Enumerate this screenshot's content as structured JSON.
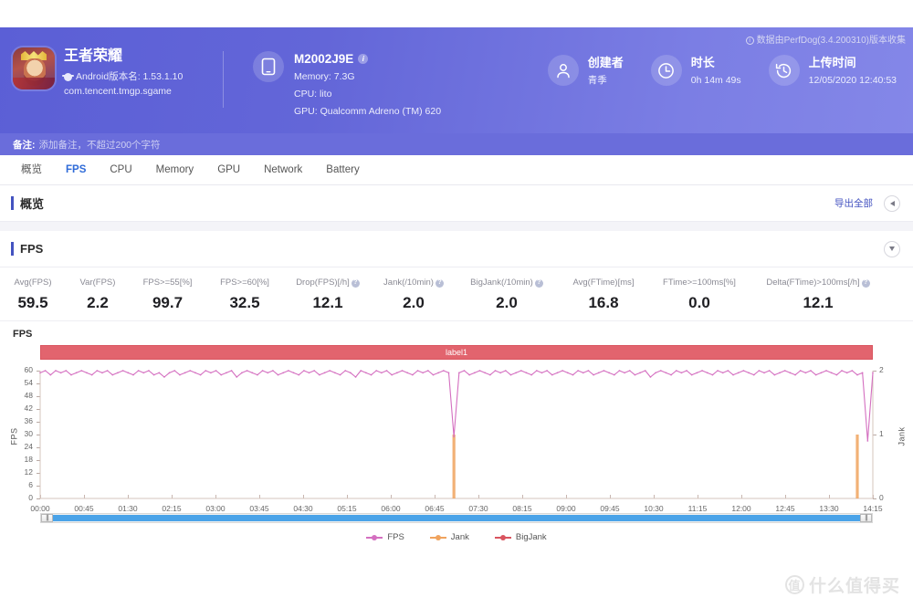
{
  "header": {
    "collector_note": "数据由PerfDog(3.4.200310)版本收集",
    "app": {
      "name": "王者荣耀",
      "version_line": "Android版本名: 1.53.1.10",
      "package": "com.tencent.tmgp.sgame"
    },
    "device": {
      "model": "M2002J9E",
      "memory": "Memory: 7.3G",
      "cpu": "CPU: lito",
      "gpu": "GPU: Qualcomm Adreno (TM) 620"
    },
    "meta": [
      {
        "icon": "user-icon",
        "label": "创建者",
        "value": "青季"
      },
      {
        "icon": "clock-icon",
        "label": "时长",
        "value": "0h 14m 49s"
      },
      {
        "icon": "history-icon",
        "label": "上传时间",
        "value": "12/05/2020 12:40:53"
      }
    ],
    "note": {
      "label": "备注:",
      "placeholder": "添加备注，不超过200个字符"
    }
  },
  "tabs": [
    {
      "label": "概览",
      "active": false
    },
    {
      "label": "FPS",
      "active": true
    },
    {
      "label": "CPU",
      "active": false
    },
    {
      "label": "Memory",
      "active": false
    },
    {
      "label": "GPU",
      "active": false
    },
    {
      "label": "Network",
      "active": false
    },
    {
      "label": "Battery",
      "active": false
    }
  ],
  "overview_section": {
    "title": "概览",
    "export_label": "导出全部"
  },
  "fps_section": {
    "title": "FPS"
  },
  "metrics": [
    {
      "label": "Avg(FPS)",
      "value": "59.5",
      "help": false
    },
    {
      "label": "Var(FPS)",
      "value": "2.2",
      "help": false
    },
    {
      "label": "FPS>=55[%]",
      "value": "99.7",
      "help": false
    },
    {
      "label": "FPS>=60[%]",
      "value": "32.5",
      "help": false
    },
    {
      "label": "Drop(FPS)[/h]",
      "value": "12.1",
      "help": true
    },
    {
      "label": "Jank(/10min)",
      "value": "2.0",
      "help": true
    },
    {
      "label": "BigJank(/10min)",
      "value": "2.0",
      "help": true
    },
    {
      "label": "Avg(FTime)[ms]",
      "value": "16.8",
      "help": false
    },
    {
      "label": "FTime>=100ms[%]",
      "value": "0.0",
      "help": false
    },
    {
      "label": "Delta(FTime)>100ms[/h]",
      "value": "12.1",
      "help": true
    }
  ],
  "chart_data": {
    "type": "line",
    "title": "FPS",
    "label_band": "label1",
    "xlabel": "",
    "ylabel": "FPS",
    "y2label": "Jank",
    "ylim": [
      0,
      60
    ],
    "y2lim": [
      0,
      2
    ],
    "yticks": [
      0,
      6,
      12,
      18,
      24,
      30,
      36,
      42,
      48,
      54,
      60
    ],
    "y2ticks": [
      0,
      1,
      2
    ],
    "xticks": [
      "00:00",
      "00:45",
      "01:30",
      "02:15",
      "03:00",
      "03:45",
      "04:30",
      "05:15",
      "06:00",
      "06:45",
      "07:30",
      "08:15",
      "09:00",
      "09:45",
      "10:30",
      "11:15",
      "12:00",
      "12:45",
      "13:30",
      "14:15"
    ],
    "grid": false,
    "legend_position": "bottom",
    "series": [
      {
        "name": "FPS",
        "axis": "left",
        "color": "#d46fc0",
        "note": "Oscillates between 57 and 60 for the whole 14m49s run; two deep drops to ~29 at 07:22 and to ~27 at 14:36",
        "values": [
          59,
          60,
          58,
          60,
          59,
          60,
          58,
          59,
          60,
          59,
          58,
          60,
          59,
          60,
          58,
          59,
          60,
          59,
          58,
          60,
          59,
          60,
          58,
          59,
          57,
          59,
          60,
          58,
          59,
          60,
          59,
          58,
          60,
          59,
          60,
          58,
          59,
          60,
          57,
          59,
          60,
          59,
          58,
          60,
          59,
          60,
          58,
          59,
          60,
          59,
          58,
          60,
          59,
          60,
          58,
          59,
          60,
          59,
          58,
          60,
          59,
          57,
          60,
          59,
          58,
          60,
          59,
          60,
          58,
          59,
          60,
          59,
          58,
          60,
          59,
          60,
          58,
          59,
          60,
          59,
          29,
          59,
          60,
          58,
          59,
          60,
          59,
          58,
          60,
          59,
          60,
          58,
          59,
          60,
          59,
          58,
          60,
          59,
          60,
          58,
          59,
          60,
          59,
          58,
          60,
          59,
          60,
          58,
          59,
          60,
          59,
          58,
          60,
          59,
          60,
          58,
          59,
          60,
          57,
          59,
          60,
          59,
          58,
          60,
          59,
          60,
          58,
          59,
          60,
          59,
          58,
          60,
          59,
          60,
          58,
          59,
          60,
          59,
          58,
          60,
          59,
          60,
          58,
          59,
          60,
          59,
          58,
          60,
          59,
          60,
          58,
          59,
          60,
          59,
          58,
          60,
          59,
          60,
          58,
          59,
          27,
          59
        ]
      },
      {
        "name": "Jank",
        "axis": "right",
        "color": "#f0a35e",
        "note": "Two single-sample spikes to 1 jank",
        "spikes": [
          {
            "x_index": 80,
            "value": 1
          },
          {
            "x_index": 158,
            "value": 1
          }
        ]
      },
      {
        "name": "BigJank",
        "axis": "right",
        "color": "#d9545f",
        "note": "No visible bars in the plotted window",
        "spikes": []
      }
    ]
  },
  "legend": [
    {
      "label": "FPS",
      "color": "#d46fc0"
    },
    {
      "label": "Jank",
      "color": "#f0a35e"
    },
    {
      "label": "BigJank",
      "color": "#d9545f"
    }
  ],
  "scrollbar": {
    "left_grip": "|||",
    "right_grip": "|||"
  },
  "watermark": {
    "mark": "值",
    "text": "什么值得买"
  },
  "colors": {
    "header_start": "#5b5fd6",
    "header_end": "#8487e8",
    "accent": "#4453c0",
    "tab_active": "#2f6bd8",
    "label_band": "#e2646e",
    "scroll_track": "#4aa3e8"
  }
}
